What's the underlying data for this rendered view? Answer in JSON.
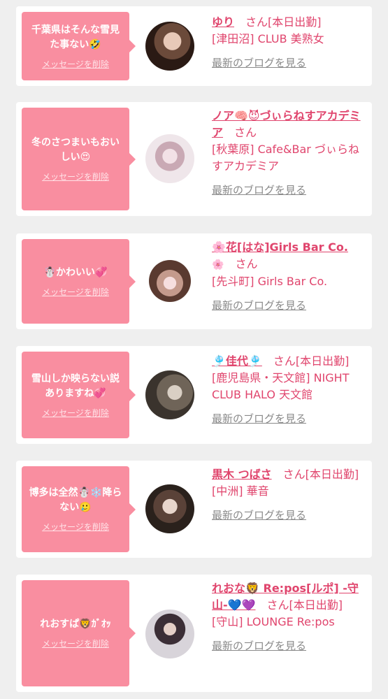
{
  "cards": [
    {
      "message": "千葉県はそんな雪見た事ない🤣",
      "delete_label": "メッセージを削除",
      "name": "ゆり",
      "honorific": "さん[本日出勤]",
      "shop": "[津田沼] CLUB 美熟女",
      "blog_label": "最新のブログを見る"
    },
    {
      "message": "冬のさつまいもおいしい😍",
      "delete_label": "メッセージを削除",
      "name": "ノア🧠😈づぃらねすアカデミア",
      "honorific": "さん",
      "shop": "[秋葉原] Cafe&Bar づぃらねすアカデミア",
      "blog_label": "最新のブログを見る"
    },
    {
      "message": "☃️かわいい💞",
      "delete_label": "メッセージを削除",
      "name": "🌸花[はな]Girls Bar Co.",
      "name_suffix": "🌸",
      "honorific": "さん",
      "shop": "[先斗町] Girls Bar Co.",
      "blog_label": "最新のブログを見る"
    },
    {
      "message": "雪山しか映らない説ありますね💞",
      "delete_label": "メッセージを削除",
      "name": "🎐佳代🎐",
      "honorific": "さん[本日出勤]",
      "shop": "[鹿児島県・天文館] NIGHT CLUB HALO 天文館",
      "blog_label": "最新のブログを見る"
    },
    {
      "message": "博多は全然☃️❄️降らない🥲",
      "delete_label": "メッセージを削除",
      "name": "黒木 つばさ",
      "honorific": "さん[本日出勤]",
      "shop": "[中洲] 華音",
      "blog_label": "最新のブログを見る"
    },
    {
      "message": "れおすぱ🦁ｶﾞｵｯ",
      "delete_label": "メッセージを削除",
      "name": "れおな🦁 Re:pos[ルポ] -守山-💙💜",
      "honorific": "さん[本日出勤]",
      "shop": "[守山] LOUNGE Re:pos",
      "blog_label": "最新のブログを見る"
    }
  ]
}
